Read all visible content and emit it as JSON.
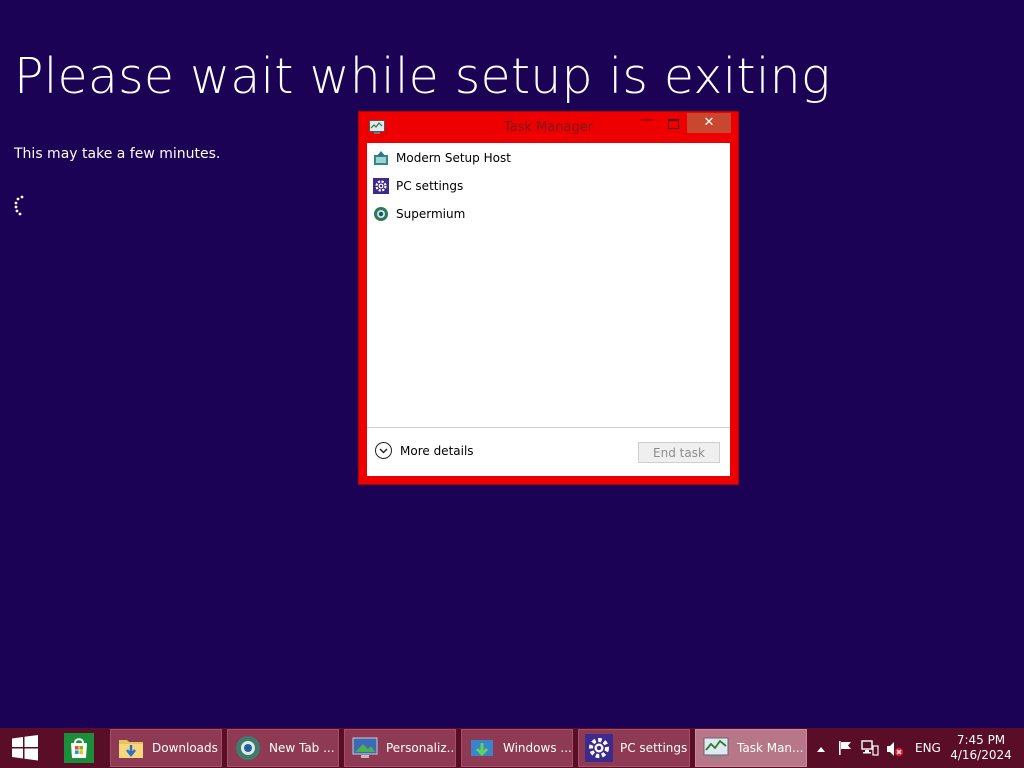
{
  "setup": {
    "title": "Please wait while setup is exiting",
    "subtitle": "This may take a few minutes."
  },
  "task_manager": {
    "title": "Task Manager",
    "close_glyph": "✕",
    "minimize_glyph": "—",
    "items": [
      {
        "label": "Modern Setup Host",
        "icon": "modern-setup-host-icon"
      },
      {
        "label": "PC settings",
        "icon": "gear-icon"
      },
      {
        "label": "Supermium",
        "icon": "supermium-browser-icon"
      }
    ],
    "more_details": "More details",
    "end_task": "End task"
  },
  "taskbar": {
    "buttons": [
      {
        "label": "Downloads",
        "icon": "folder-download-icon"
      },
      {
        "label": "New Tab ...",
        "icon": "browser-icon"
      },
      {
        "label": "Personaliz...",
        "icon": "personalize-monitor-icon"
      },
      {
        "label": "Windows ...",
        "icon": "windows-update-icon"
      },
      {
        "label": "PC settings",
        "icon": "gear-icon"
      },
      {
        "label": "Task Man...",
        "icon": "task-manager-icon"
      }
    ],
    "active_button": "Task Man...",
    "tray": {
      "language": "ENG",
      "time": "7:45 PM",
      "date": "4/16/2024"
    }
  },
  "colors": {
    "desktop_background": "#1b0254",
    "taskbar": "#5a0d27",
    "window_frame": "#ee0000",
    "close_button": "#c7482f"
  }
}
